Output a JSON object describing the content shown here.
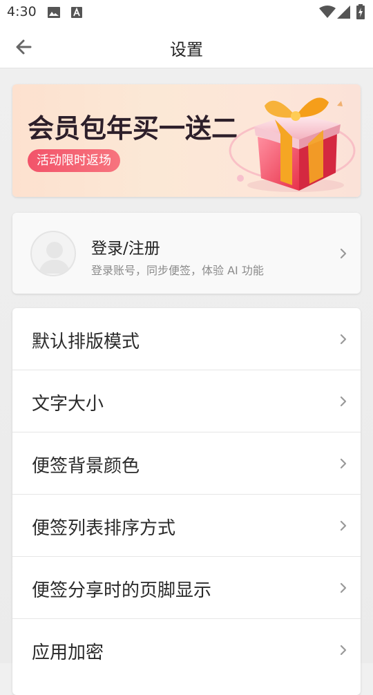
{
  "status_bar": {
    "time": "4:30",
    "icons": [
      "image-icon",
      "font-a-icon",
      "wifi-icon",
      "signal-icon",
      "battery-charging-icon"
    ]
  },
  "header": {
    "title": "设置",
    "back_icon": "arrow-left-icon"
  },
  "banner": {
    "headline": "会员包年买一送二",
    "pill": "活动限时返场",
    "illustration": "gift-box-icon"
  },
  "login": {
    "title": "登录/注册",
    "subtitle": "登录账号，同步便签，体验 AI 功能",
    "avatar_icon": "user-avatar-icon"
  },
  "settings": {
    "items": [
      {
        "label": "默认排版模式"
      },
      {
        "label": "文字大小"
      },
      {
        "label": "便签背景颜色"
      },
      {
        "label": "便签列表排序方式"
      },
      {
        "label": "便签分享时的页脚显示"
      },
      {
        "label": "应用加密"
      }
    ]
  },
  "colors": {
    "accent_pill": "#f2546a",
    "headline_text": "#2d1f2a",
    "subtitle_text": "#8a8a8a"
  }
}
